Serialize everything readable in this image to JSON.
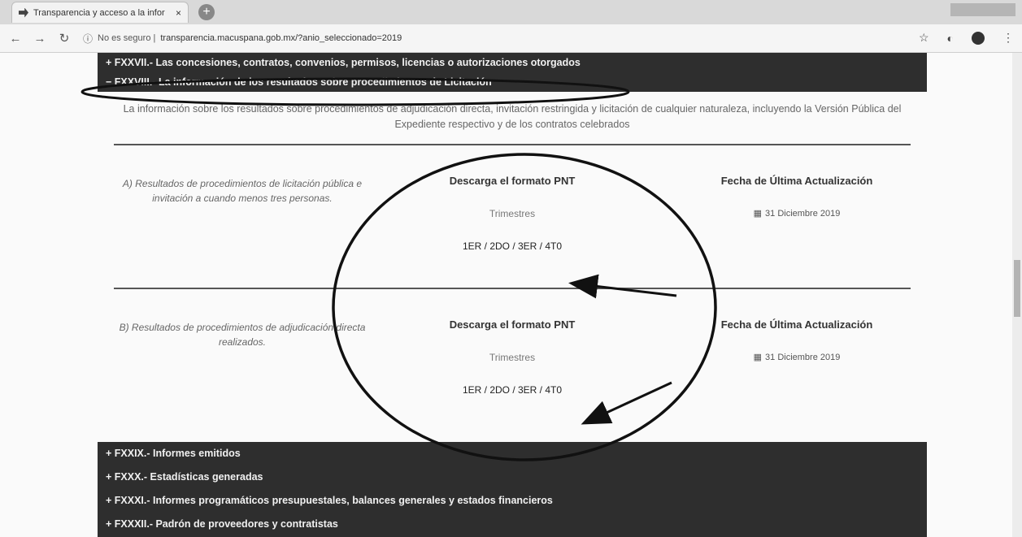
{
  "browser": {
    "tab_title": "Transparencia y acceso a la infor",
    "tab_close": "×",
    "new_tab": "+",
    "url_security": "No es seguro",
    "url": "transparencia.macuspana.gob.mx/?anio_seleccionado=2019"
  },
  "sections": {
    "top_rows": [
      {
        "label": "+ FXXVII.- Las concesiones, contratos, convenios, permisos, licencias o autorizaciones otorgados"
      },
      {
        "label": "− FXXVIII.- La información de los resultados sobre procedimientos de Licitación"
      }
    ],
    "description": "La información sobre los resultados sobre procedimientos de adjudicación directa, invitación restringida y licitación de cualquier naturaleza, incluyendo la Versión Pública del Expediente respectivo y de los contratos celebrados",
    "items": [
      {
        "title": "A) Resultados de procedimientos de licitación pública e invitación a cuando menos tres personas.",
        "download_heading": "Descarga el formato PNT",
        "trimestres_label": "Trimestres",
        "quarters": "1ER / 2DO / 3ER / 4T0",
        "date_heading": "Fecha de Última Actualización",
        "date": "31 Diciembre 2019"
      },
      {
        "title": "B) Resultados de procedimientos de adjudicación directa realizados.",
        "download_heading": "Descarga el formato PNT",
        "trimestres_label": "Trimestres",
        "quarters": "1ER / 2DO / 3ER / 4T0",
        "date_heading": "Fecha de Última Actualización",
        "date": "31 Diciembre 2019"
      }
    ],
    "bottom_rows": [
      {
        "label": "+ FXXIX.- Informes emitidos"
      },
      {
        "label": "+ FXXX.- Estadísticas generadas"
      },
      {
        "label": "+ FXXXI.- Informes programáticos presupuestales, balances generales y estados financieros"
      },
      {
        "label": "+ FXXXII.- Padrón de proveedores y contratistas"
      }
    ]
  },
  "colors": {
    "dark_row": "#2e2e2e",
    "annotation": "#111111"
  }
}
